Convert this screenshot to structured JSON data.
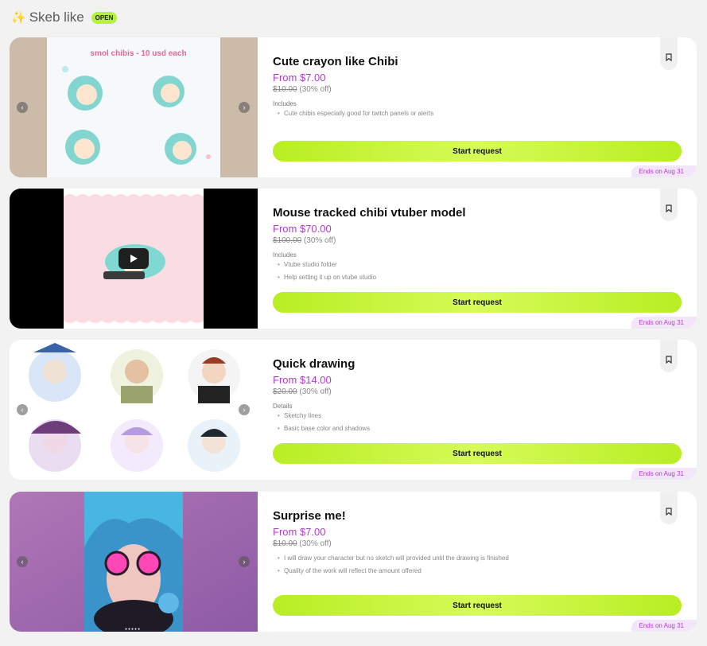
{
  "header": {
    "title": "Skeb like",
    "badge": "OPEN"
  },
  "labels": {
    "start_request": "Start request",
    "prev": "‹",
    "next": "›"
  },
  "commissions": [
    {
      "name": "Cute crayon like Chibi",
      "price": "From $7.00",
      "old_price": "$10.00",
      "discount": "(30% off)",
      "includes_label": "Includes",
      "includes": [
        "Cute chibis especially good for twitch panels or alerts"
      ],
      "ends": "Ends on Aug 31",
      "image_text": "smol chibis - 10 usd each"
    },
    {
      "name": "Mouse tracked chibi vtuber model",
      "price": "From $70.00",
      "old_price": "$100.00",
      "discount": "(30% off)",
      "includes_label": "Includes",
      "includes": [
        "Vtube studio folder",
        "Help setting it up on vtube studio"
      ],
      "ends": "Ends on Aug 31"
    },
    {
      "name": "Quick drawing",
      "price": "From $14.00",
      "old_price": "$20.00",
      "discount": "(30% off)",
      "includes_label": "Details",
      "includes": [
        "Sketchy lines",
        "Basic base color and shadows"
      ],
      "ends": "Ends on Aug 31"
    },
    {
      "name": "Surprise me!",
      "price": "From $7.00",
      "old_price": "$10.00",
      "discount": "(30% off)",
      "includes_label": "",
      "includes": [
        "I will draw your character but no sketch will provided until the drawing is finished",
        "Quality of the work will reflect the amount offered"
      ],
      "ends": "Ends on Aug 31"
    }
  ],
  "colors": {
    "accent": "#b43ad6",
    "button": "#c6f531",
    "badge": "#b7f23a"
  },
  "icons": {
    "sparkle": "sparkles-icon",
    "bookmark": "bookmark-icon",
    "play": "play-icon"
  }
}
